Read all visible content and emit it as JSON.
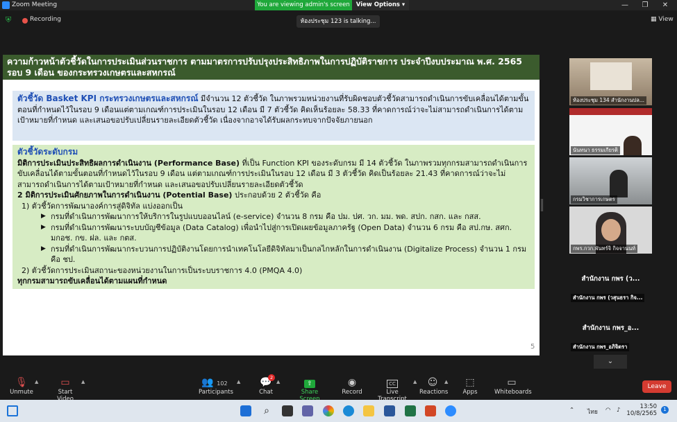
{
  "window": {
    "title": "Zoom Meeting",
    "viewing_banner": "You are viewing admin's screen",
    "view_options": "View Options ▾"
  },
  "meeting": {
    "recording": "Recording",
    "talking": "ห้องประชุม 123 is  talking...",
    "view": "View"
  },
  "slide": {
    "header_line1": "ความก้าวหน้าตัวชี้วัดในการประเมินส่วนราชการ ตามมาตรการปรับปรุงประสิทธิภาพในการปฏิบัติราชการ ประจำปีงบประมาณ พ.ศ. 2565",
    "header_line2": "รอบ 9 เดือน ของกระทรวงเกษตรและสหกรณ์",
    "box1_title": "ตัวชี้วัด Basket KPI กระทรวงเกษตรและสหกรณ์",
    "box1_text": " มีจำนวน 12 ตัวชี้วัด ในภาพรวมหน่วยงานที่รับผิดชอบตัวชี้วัดสามารถดำเนินการขับเคลื่อนได้ตามขั้นตอนที่กำหนดไว้ในรอบ 9 เดือนแต่ตามเกณฑ์การประเมินในรอบ 12 เดือน มี 7 ตัวชี้วัด คิดเห็นร้อยละ 58.33 ที่คาดการณ์ว่าจะไม่สามารถดำเนินการได้ตามเป้าหมายที่กำหนด และเสนอขอปรับเปลี่ยนรายละเอียดตัวชี้วัด เนื่องจากอาจได้รับผลกระทบจากปัจจัยภายนอก",
    "box2_title": "ตัวชี้วัดระดับกรม",
    "perf_bold": "มิติการประเมินประสิทธิผลการดำเนินงาน (Performance Base)",
    "perf_text": " ที่เป็น Function KPI ของระดับกรม มี 14 ตัวชี้วัด ในภาพรวมทุกกรมสามารถดำเนินการขับเคลื่อนได้ตามขั้นตอนที่กำหนดไว้ในรอบ 9 เดือน แต่ตามเกณฑ์การประเมินในรอบ 12 เดือน มี 3 ตัวชี้วัด คิดเป็นร้อยละ 21.43 ที่คาดการณ์ว่าจะไม่สามารถดำเนินการได้ตามเป้าหมายที่กำหนด และเสนอขอปรับเปลี่ยนรายละเอียดตัวชี้วัด",
    "pot_bold": "2 มิติการประเมินศักยภาพในการดำเนินงาน (Potential Base)",
    "pot_text": " ประกอบด้วย 2 ตัวชี้วัด คือ",
    "item1": "1) ตัวชี้วัดการพัฒนาองค์การสู่ดิจิทัล แบ่งออกเป็น",
    "bullet1": "กรมที่ดำเนินการพัฒนาการให้บริการในรูปแบบออนไลน์ (e-service) จำนวน 8 กรม คือ ปม. ปศ. วก. มม. พด. สปก. กสก. และ กสส.",
    "bullet2": "กรมที่ดำเนินการพัฒนาระบบบัญชีข้อมูล (Data Catalog) เพื่อนำไปสู่การเปิดเผยข้อมูลภาครัฐ (Open Data) จำนวน 6 กรม คือ สป.กษ. สศก. มกอช. กข. ฝล. และ กตส.",
    "bullet3": "กรมที่ดำเนินการพัฒนากระบวนการปฏิบัติงานโดยการนำเทคโนโลยีดิจิทัลมาเป็นกลไกหลักในการดำเนินงาน (Digitalize Process) จำนวน 1 กรม คือ ชป.",
    "item2": "2) ตัวชี้วัดการประเมินสถานะของหน่วยงานในการเป็นระบบราชการ 4.0 (PMQA 4.0)",
    "closing": "ทุกกรมสามารถขับเคลื่อนได้ตามแผนที่กำหนด",
    "page": "5"
  },
  "participants_panel": [
    {
      "name": "ห้องประชุม 134 สำนักงานปล..."
    },
    {
      "name": "นันทนา ธรรมเกียรติ"
    },
    {
      "name": "กรมวิชาการเกษตร"
    },
    {
      "name": "กพร.กวก.พันทร์จิ กิจจานนท์"
    },
    {
      "title": "สำนักงาน กพร (ว...",
      "name": "สำนักงาน กพร (วสุนธรา กิจ..."
    },
    {
      "title": "สำนักงาน กพร_อ...",
      "name": "สำนักงาน กพร_อภิจิตรา"
    }
  ],
  "toolbar": {
    "unmute": "Unmute",
    "start_video": "Start Video",
    "participants": "Participants",
    "participants_count": "102",
    "chat": "Chat",
    "chat_badge": "2",
    "share": "Share Screen",
    "record": "Record",
    "transcript": "Live Transcript",
    "reactions": "Reactions",
    "apps": "Apps",
    "whiteboards": "Whiteboards",
    "leave": "Leave"
  },
  "taskbar": {
    "lang": "ไทย",
    "time": "13:50",
    "date": "10/8/2565",
    "notif": "1"
  },
  "colors": {
    "slide_header": "#3b5b2d",
    "box1": "#dbe6f3",
    "box2": "#d7ecc4",
    "share_green": "#1fa83a",
    "leave_red": "#d43b31"
  }
}
